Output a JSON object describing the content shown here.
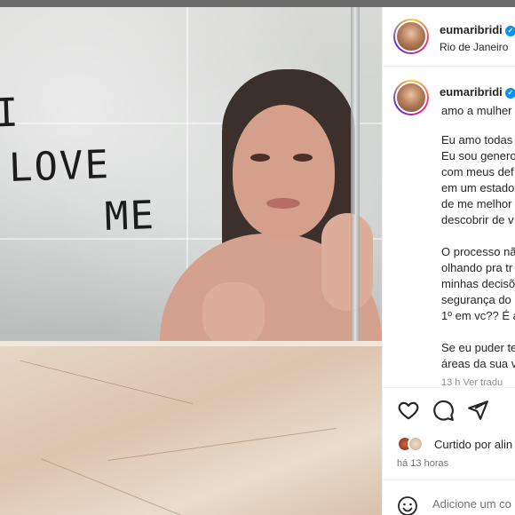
{
  "post": {
    "author": "eumaribridi",
    "location": "Rio de Janeiro",
    "image": {
      "mirror_text_line1": "I",
      "mirror_text_line2": "LOVE",
      "mirror_text_line3": "ME"
    },
    "caption": {
      "author": "eumaribridi",
      "first_line": "amo a mulher",
      "lines": [
        "Eu amo todas",
        "Eu sou genero",
        "com meus def",
        "em um estado",
        "de me melhor",
        "descobrir de v",
        "",
        "O processo nã",
        "olhando pra tr",
        "minhas decisõ",
        "segurança do",
        "1º em vc?? É a",
        "",
        "Se eu puder te",
        "áreas da sua v"
      ],
      "meta": "13 h   Ver tradu"
    },
    "likes": {
      "liked_by_text": "Curtido por alin"
    },
    "time_ago": "há 13 horas",
    "comment": {
      "placeholder": "Adicione um co"
    }
  },
  "colors": {
    "verified": "#0095f6",
    "story_ring": [
      "#f9ce34",
      "#ee2a7b",
      "#6228d7"
    ]
  },
  "icons": [
    "verified-badge-icon",
    "heart-icon",
    "comment-icon",
    "share-icon",
    "emoji-icon"
  ]
}
